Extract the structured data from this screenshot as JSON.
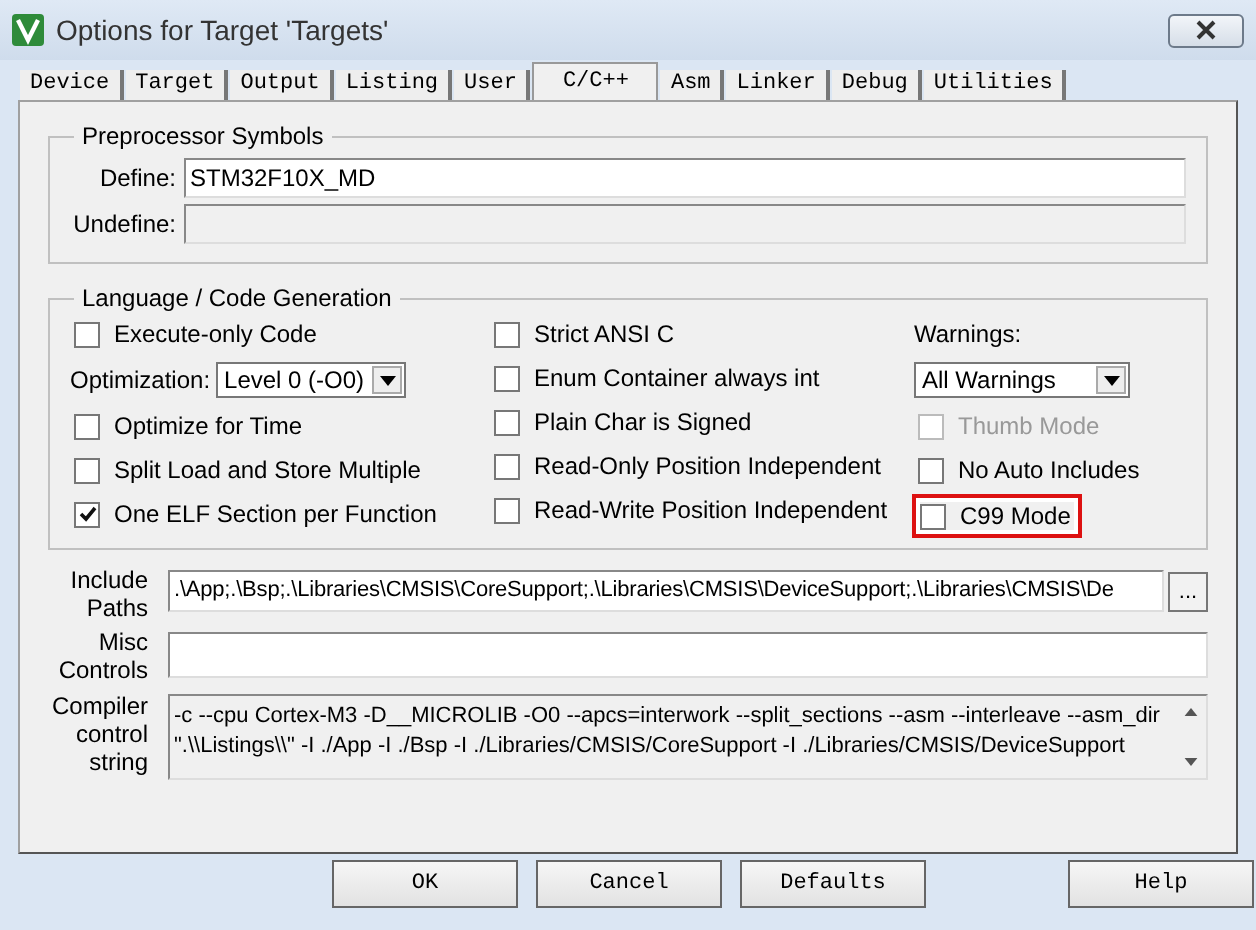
{
  "window": {
    "title": "Options for Target 'Targets'"
  },
  "tabs": [
    {
      "label": "Device",
      "selected": false
    },
    {
      "label": "Target",
      "selected": false
    },
    {
      "label": "Output",
      "selected": false
    },
    {
      "label": "Listing",
      "selected": false
    },
    {
      "label": "User",
      "selected": false
    },
    {
      "label": "C/C++",
      "selected": true
    },
    {
      "label": "Asm",
      "selected": false
    },
    {
      "label": "Linker",
      "selected": false
    },
    {
      "label": "Debug",
      "selected": false
    },
    {
      "label": "Utilities",
      "selected": false
    }
  ],
  "preprocessor": {
    "title": "Preprocessor Symbols",
    "define": {
      "label": "Define:",
      "value": "STM32F10X_MD"
    },
    "undefine": {
      "label": "Undefine:"
    }
  },
  "language": {
    "title": "Language / Code Generation",
    "columns": [
      [
        {
          "kind": "checkbox",
          "label": "Execute-only Code",
          "checked": false,
          "disabled": false,
          "highlighted": false
        },
        {
          "kind": "select",
          "label": "Optimization:",
          "value": "Level 0 (-O0)"
        },
        {
          "kind": "checkbox",
          "label": "Optimize for Time",
          "checked": false,
          "disabled": false,
          "highlighted": false
        },
        {
          "kind": "checkbox",
          "label": "Split Load and Store Multiple",
          "checked": false,
          "disabled": false,
          "highlighted": false
        },
        {
          "kind": "checkbox",
          "label": "One ELF Section per Function",
          "checked": true,
          "disabled": false,
          "highlighted": false
        }
      ],
      [
        {
          "kind": "checkbox",
          "label": "Strict ANSI C",
          "checked": false,
          "disabled": false,
          "highlighted": false
        },
        {
          "kind": "checkbox",
          "label": "Enum Container always int",
          "checked": false,
          "disabled": false,
          "highlighted": false
        },
        {
          "kind": "checkbox",
          "label": "Plain Char is Signed",
          "checked": false,
          "disabled": false,
          "highlighted": false
        },
        {
          "kind": "checkbox",
          "label": "Read-Only Position Independent",
          "checked": false,
          "disabled": false,
          "highlighted": false
        },
        {
          "kind": "checkbox",
          "label": "Read-Write Position Independent",
          "checked": false,
          "disabled": false,
          "highlighted": false
        }
      ],
      [
        {
          "kind": "label",
          "label": "Warnings:"
        },
        {
          "kind": "select",
          "value": "All Warnings"
        },
        {
          "kind": "checkbox",
          "label": "Thumb Mode",
          "checked": false,
          "disabled": true,
          "highlighted": false
        },
        {
          "kind": "checkbox",
          "label": "No Auto Includes",
          "checked": false,
          "disabled": false,
          "highlighted": false
        },
        {
          "kind": "checkbox",
          "label": "C99 Mode",
          "checked": false,
          "disabled": false,
          "highlighted": true
        }
      ]
    ]
  },
  "include_paths": {
    "label": "Include Paths",
    "value": ".\\App;.\\Bsp;.\\Libraries\\CMSIS\\CoreSupport;.\\Libraries\\CMSIS\\DeviceSupport;.\\Libraries\\CMSIS\\De",
    "browse": "..."
  },
  "misc_controls": {
    "label": "Misc Controls"
  },
  "compiler_string": {
    "label": "Compiler control string",
    "lines": [
      "-c --cpu Cortex-M3 -D__MICROLIB -O0 --apcs=interwork --split_sections --asm --interleave --asm_dir",
      "\".\\\\Listings\\\\\" -I ./App -I ./Bsp -I ./Libraries/CMSIS/CoreSupport -I ./Libraries/CMSIS/DeviceSupport"
    ]
  },
  "buttons": [
    "OK",
    "Cancel",
    "Defaults",
    "Help"
  ]
}
